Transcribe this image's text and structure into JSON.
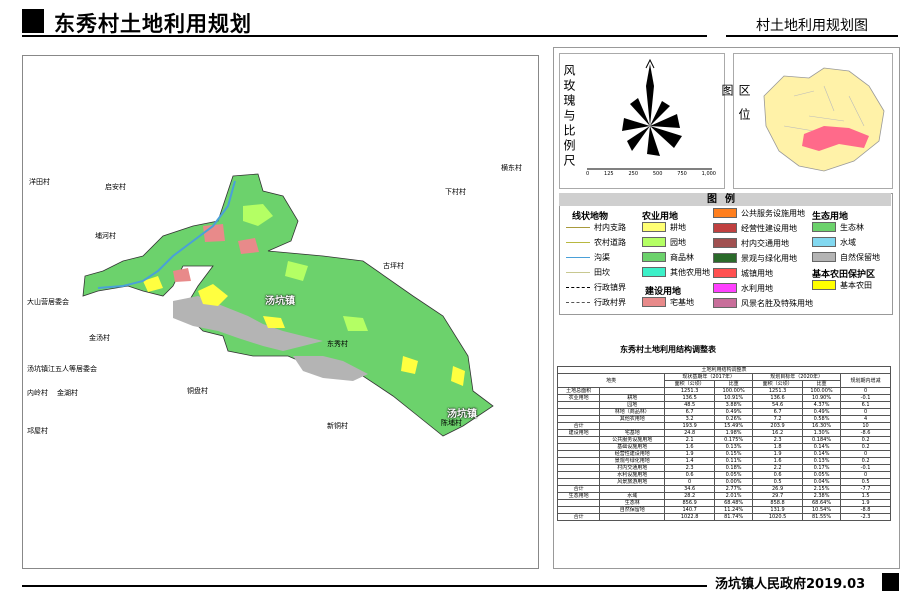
{
  "header": {
    "title": "东秀村土地利用规划",
    "subtitle": "村土地利用规划图"
  },
  "map": {
    "places": {
      "yangtian": "洋田村",
      "qi_an": "启安村",
      "henghe": "埔河村",
      "hengdong": "横东村",
      "xiatian": "下村村",
      "gupo": "古坪村",
      "dashan": "大山营居委会",
      "jinshan": "金汤村",
      "tangkeng_jianghong": "汤坑镇江五人等居委会",
      "neiling": "内岭村",
      "jinhu": "金湖村",
      "tongpan": "铜盘村",
      "xinzhou": "新铜村",
      "qiuwu": "邛屋村",
      "chenpu": "陈埔村",
      "dongxiu": "东秀村"
    },
    "town_labels": [
      "汤坑镇",
      "汤坑镇"
    ]
  },
  "compass": {
    "label": "风玫瑰与比例尺",
    "scale_ticks": [
      "0",
      "125",
      "250",
      "500",
      "750",
      "1,000"
    ]
  },
  "location": {
    "label": "区位图"
  },
  "legend": {
    "title": "图例",
    "line_heading": "线状地物",
    "lines": [
      {
        "label": "村内支路",
        "color": "#a89a3c"
      },
      {
        "label": "农村道路",
        "color": "#b8b840"
      },
      {
        "label": "沟渠",
        "color": "#4aa0d8"
      },
      {
        "label": "田坎",
        "color": "#c8c890"
      },
      {
        "label": "行政镇界",
        "color": "#000000"
      },
      {
        "label": "行政村界",
        "color": "#555555"
      }
    ],
    "agri_heading": "农业用地",
    "agri": [
      {
        "label": "耕地",
        "color": "#ffff73"
      },
      {
        "label": "园地",
        "color": "#b4ff64"
      },
      {
        "label": "商品林",
        "color": "#6cd26c"
      },
      {
        "label": "其他农用地",
        "color": "#3cf0c8"
      }
    ],
    "build_heading": "建设用地",
    "build": [
      {
        "label": "宅基地",
        "color": "#e88a8a"
      }
    ],
    "pub": [
      {
        "label": "公共服务设施用地",
        "color": "#ff7f1e"
      },
      {
        "label": "经营性建设用地",
        "color": "#c04040"
      },
      {
        "label": "村内交通用地",
        "color": "#a05050"
      },
      {
        "label": "景观与绿化用地",
        "color": "#2a6a2a"
      },
      {
        "label": "城镇用地",
        "color": "#ff5050"
      },
      {
        "label": "水利用地",
        "color": "#ff40ff"
      },
      {
        "label": "风景名胜及特殊用地",
        "color": "#c86e9a"
      }
    ],
    "eco_heading": "生态用地",
    "eco": [
      {
        "label": "生态林",
        "color": "#6cd26c"
      },
      {
        "label": "水域",
        "color": "#82d8f0"
      },
      {
        "label": "自然保留地",
        "color": "#b4b4b4"
      }
    ],
    "farm_heading": "基本农田保护区",
    "farm": [
      {
        "label": "基本农田",
        "color": "#ffff00"
      }
    ]
  },
  "table": {
    "title": "东秀村土地利用结构调整表",
    "caption": "土地利用结构调整表",
    "col_group": "地类",
    "base_year": "现状基期年（2017年）",
    "plan_year": "规划目标年（2020年）",
    "change": "规划期内增减",
    "area": "面积（公顷）",
    "ratio": "比重",
    "rows": [
      [
        "土地总面积",
        "",
        "1251.3",
        "100.00%",
        "1251.3",
        "100.00%",
        "0"
      ],
      [
        "农业用地",
        "耕地",
        "136.5",
        "10.91%",
        "136.6",
        "10.90%",
        "-0.1"
      ],
      [
        "",
        "园地",
        "48.5",
        "3.88%",
        "54.6",
        "4.37%",
        "6.1"
      ],
      [
        "",
        "林地（商品林）",
        "6.7",
        "0.49%",
        "6.7",
        "0.49%",
        "0"
      ],
      [
        "",
        "其他农用地",
        "3.2",
        "0.26%",
        "7.2",
        "0.58%",
        "4"
      ],
      [
        "合计",
        "",
        "193.9",
        "15.49%",
        "203.9",
        "16.30%",
        "10"
      ],
      [
        "建设用地",
        "宅基地",
        "24.8",
        "1.98%",
        "16.2",
        "1.30%",
        "-8.6"
      ],
      [
        "",
        "公共服务设施用地",
        "2.1",
        "0.175%",
        "2.3",
        "0.184%",
        "0.2"
      ],
      [
        "",
        "基础设施用地",
        "1.6",
        "0.13%",
        "1.8",
        "0.14%",
        "0.2"
      ],
      [
        "",
        "经营性建设用地",
        "1.9",
        "0.15%",
        "1.9",
        "0.14%",
        "0"
      ],
      [
        "",
        "景观与绿化用地",
        "1.4",
        "0.11%",
        "1.6",
        "0.13%",
        "0.2"
      ],
      [
        "",
        "村内交通用地",
        "2.3",
        "0.18%",
        "2.2",
        "0.17%",
        "-0.1"
      ],
      [
        "",
        "水利设施用地",
        "0.6",
        "0.05%",
        "0.6",
        "0.05%",
        "0"
      ],
      [
        "",
        "风景旅游用地",
        "0",
        "0.00%",
        "0.5",
        "0.04%",
        "0.5"
      ],
      [
        "合计",
        "",
        "34.6",
        "2.77%",
        "26.9",
        "2.15%",
        "-7.7"
      ],
      [
        "生态用地",
        "水域",
        "28.2",
        "2.01%",
        "29.7",
        "2.38%",
        "1.5"
      ],
      [
        "",
        "生态林",
        "856.9",
        "68.48%",
        "858.8",
        "68.64%",
        "1.9"
      ],
      [
        "",
        "自然保留地",
        "140.7",
        "11.24%",
        "131.9",
        "10.54%",
        "-8.8"
      ],
      [
        "合计",
        "",
        "1022.8",
        "81.74%",
        "1020.5",
        "81.55%",
        "-2.3"
      ]
    ]
  },
  "footer": {
    "text": "汤坑镇人民政府2019.03"
  }
}
